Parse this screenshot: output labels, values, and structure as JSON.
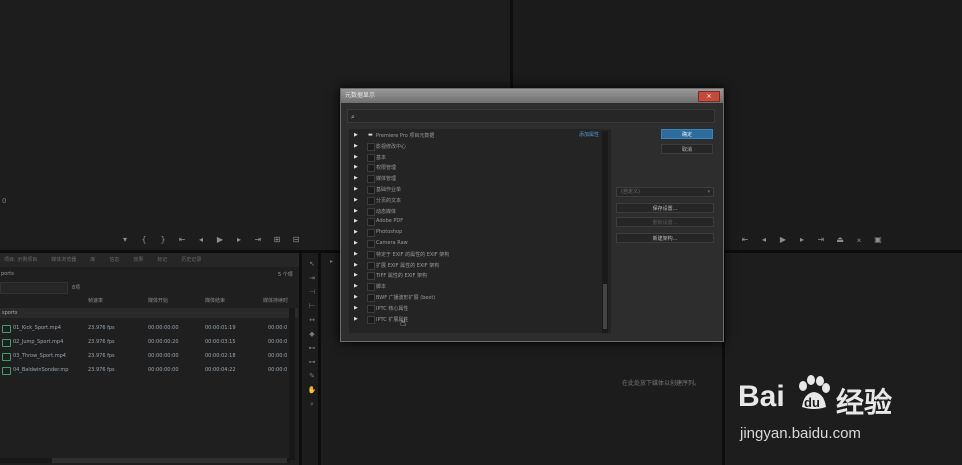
{
  "left_monitor": {
    "timecode": "0"
  },
  "project_panel": {
    "tabs": [
      "项目: 示例项目",
      "媒体浏览器",
      "库",
      "信息",
      "效果",
      "标记",
      "历史记录"
    ],
    "name_partial": "ports",
    "item_count": "5 个项",
    "search_value": "",
    "search_placeholder": "",
    "search_hint": "8项",
    "columns": [
      "帧速率",
      "媒体开始",
      "媒体结束",
      "媒体持续时"
    ],
    "bin_name": "sports",
    "rows": [
      {
        "name": "01_Kick_Sport.mp4",
        "fps": "23.976 fps",
        "start": "00:00:00:00",
        "end": "00:00:01:19",
        "dur": "00:00:0"
      },
      {
        "name": "02_Jump_Sport.mp4",
        "fps": "23.976 fps",
        "start": "00:00:00:20",
        "end": "00:00:03:15",
        "dur": "00:00:0"
      },
      {
        "name": "03_Throw_Sport.mp4",
        "fps": "23.976 fps",
        "start": "00:00:00:00",
        "end": "00:00:02:18",
        "dur": "00:00:0"
      },
      {
        "name": "04_BaldwinSonder.mp",
        "fps": "23.976 fps",
        "start": "00:00:00:00",
        "end": "00:00:04:22",
        "dur": "00:00:0"
      }
    ]
  },
  "right_panel": {
    "hint": "在此处放下媒体以创建序列。"
  },
  "dialog": {
    "title": "元数据显示",
    "close_label": "✕",
    "search_icon": "⌕",
    "add_property": "添加属性",
    "items": [
      {
        "label": "Premiere Pro 项目元数据",
        "expanded": true
      },
      {
        "label": "影视修改中心"
      },
      {
        "label": "基本"
      },
      {
        "label": "权限管理"
      },
      {
        "label": "媒体管理"
      },
      {
        "label": "基础作业单"
      },
      {
        "label": "分页的文本"
      },
      {
        "label": "动态媒体"
      },
      {
        "label": "Adobe PDF"
      },
      {
        "label": "Photoshop"
      },
      {
        "label": "Camera Raw"
      },
      {
        "label": "特定于 EXIF 的属性的 EXIF 架构"
      },
      {
        "label": "扩展 EXIF 属性的 EXIF 架构"
      },
      {
        "label": "TIFF 属性的 EXIF 架构"
      },
      {
        "label": "脚本"
      },
      {
        "label": "BWF 广播波形扩展 (bext)"
      },
      {
        "label": "IPTC 核心属性"
      },
      {
        "label": "IPTC 扩展属性"
      }
    ],
    "ok_label": "确定",
    "cancel_label": "取消",
    "preset_select": "(自定义)",
    "save_settings": "保存设置...",
    "delete_settings": "删除设置...",
    "new_schema": "新建架构..."
  },
  "watermark": {
    "brand_a": "Bai",
    "brand_b": "du",
    "brand_c": "经验",
    "url": "jingyan.baidu.com"
  }
}
